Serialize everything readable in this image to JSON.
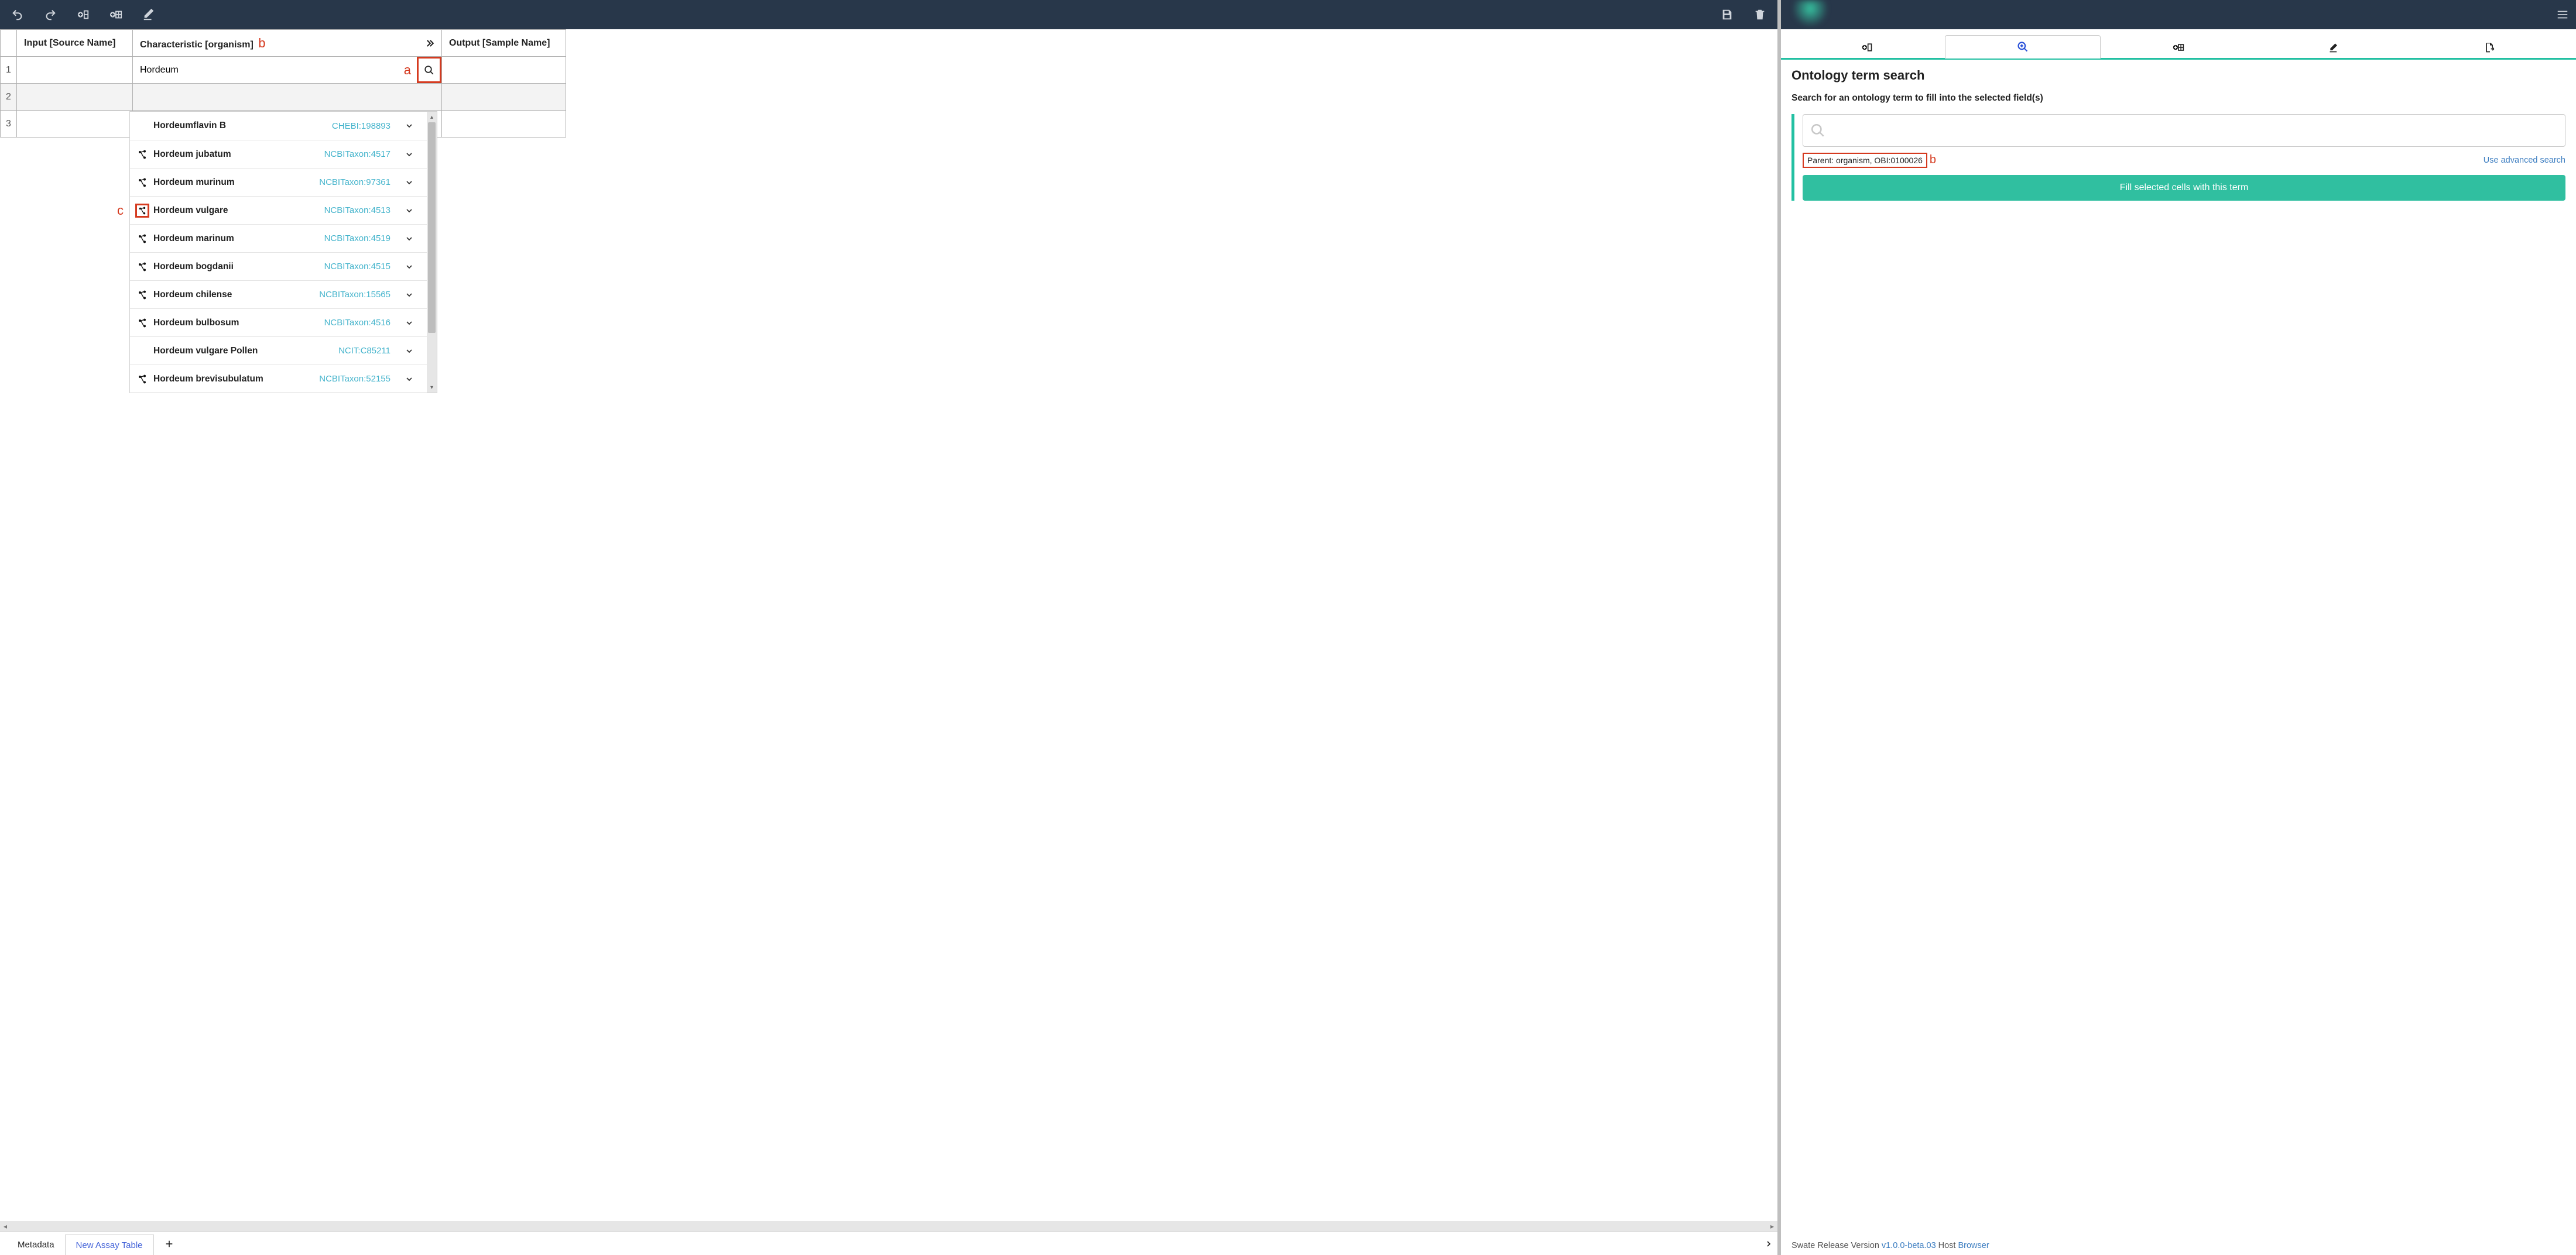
{
  "toolbar": {
    "icons": [
      "undo",
      "redo",
      "add-col",
      "add-table",
      "edit",
      "save",
      "delete"
    ]
  },
  "columns": {
    "input_header": "Input [Source Name]",
    "char_header": "Characteristic [organism]",
    "output_header": "Output [Sample Name]"
  },
  "annotations": {
    "a": "a",
    "b": "b",
    "c": "c"
  },
  "row_numbers": [
    "1",
    "2",
    "3"
  ],
  "search_value": "Hordeum",
  "dropdown": [
    {
      "tree": false,
      "term": "Hordeumflavin B",
      "id": "CHEBI:198893",
      "highlight": false
    },
    {
      "tree": true,
      "term": "Hordeum jubatum",
      "id": "NCBITaxon:4517",
      "highlight": false
    },
    {
      "tree": true,
      "term": "Hordeum murinum",
      "id": "NCBITaxon:97361",
      "highlight": false
    },
    {
      "tree": true,
      "term": "Hordeum vulgare",
      "id": "NCBITaxon:4513",
      "highlight": true
    },
    {
      "tree": true,
      "term": "Hordeum marinum",
      "id": "NCBITaxon:4519",
      "highlight": false
    },
    {
      "tree": true,
      "term": "Hordeum bogdanii",
      "id": "NCBITaxon:4515",
      "highlight": false
    },
    {
      "tree": true,
      "term": "Hordeum chilense",
      "id": "NCBITaxon:15565",
      "highlight": false
    },
    {
      "tree": true,
      "term": "Hordeum bulbosum",
      "id": "NCBITaxon:4516",
      "highlight": false
    },
    {
      "tree": false,
      "term": "Hordeum vulgare Pollen",
      "id": "NCIT:C85211",
      "highlight": false
    },
    {
      "tree": true,
      "term": "Hordeum brevisubulatum",
      "id": "NCBITaxon:52155",
      "highlight": false
    }
  ],
  "tabs": {
    "metadata": "Metadata",
    "new_assay": "New Assay Table"
  },
  "right": {
    "title": "Ontology term search",
    "subtitle": "Search for an ontology term to fill into the selected field(s)",
    "parent_text": "Parent: organism, OBI:0100026",
    "advanced": "Use advanced search",
    "fill_button": "Fill selected cells with this term"
  },
  "footer": {
    "prefix": "Swate Release Version ",
    "version": "v1.0.0-beta.03",
    "host_label": " Host ",
    "host": "Browser"
  }
}
